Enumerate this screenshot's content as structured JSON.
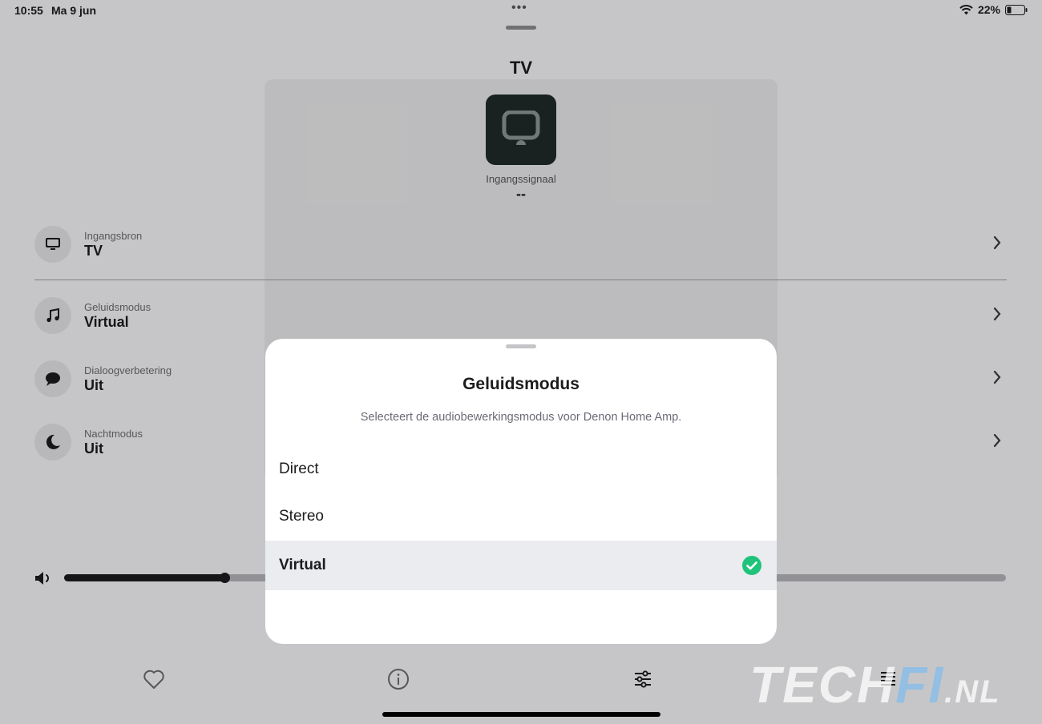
{
  "status_bar": {
    "time": "10:55",
    "date": "Ma 9 jun",
    "battery": "22%"
  },
  "header": {
    "title": "TV"
  },
  "input": {
    "label": "Ingangssignaal",
    "value": "--"
  },
  "settings": [
    {
      "label": "Ingangsbron",
      "value": "TV",
      "icon": "tv-icon"
    },
    {
      "label": "Geluidsmodus",
      "value": "Virtual",
      "icon": "music-note-icon"
    },
    {
      "label": "Dialoogverbetering",
      "value": "Uit",
      "icon": "speech-bubble-icon"
    },
    {
      "label": "Nachtmodus",
      "value": "Uit",
      "icon": "moon-icon"
    }
  ],
  "volume": {
    "level": 0.17
  },
  "tabs": [
    {
      "name": "favorites",
      "icon": "heart-icon"
    },
    {
      "name": "info",
      "icon": "info-icon"
    },
    {
      "name": "settings",
      "icon": "sliders-icon"
    },
    {
      "name": "queue",
      "icon": "list-icon"
    }
  ],
  "sheet": {
    "title": "Geluidsmodus",
    "subtitle": "Selecteert de audiobewerkingsmodus voor Denon Home Amp.",
    "options": [
      "Direct",
      "Stereo",
      "Virtual"
    ],
    "selected": "Virtual"
  },
  "watermark": {
    "part1": "TECH",
    "part2": "FI",
    "part3": ".NL"
  },
  "colors": {
    "accent": "#1fc37a",
    "text": "#1c1c1e"
  }
}
